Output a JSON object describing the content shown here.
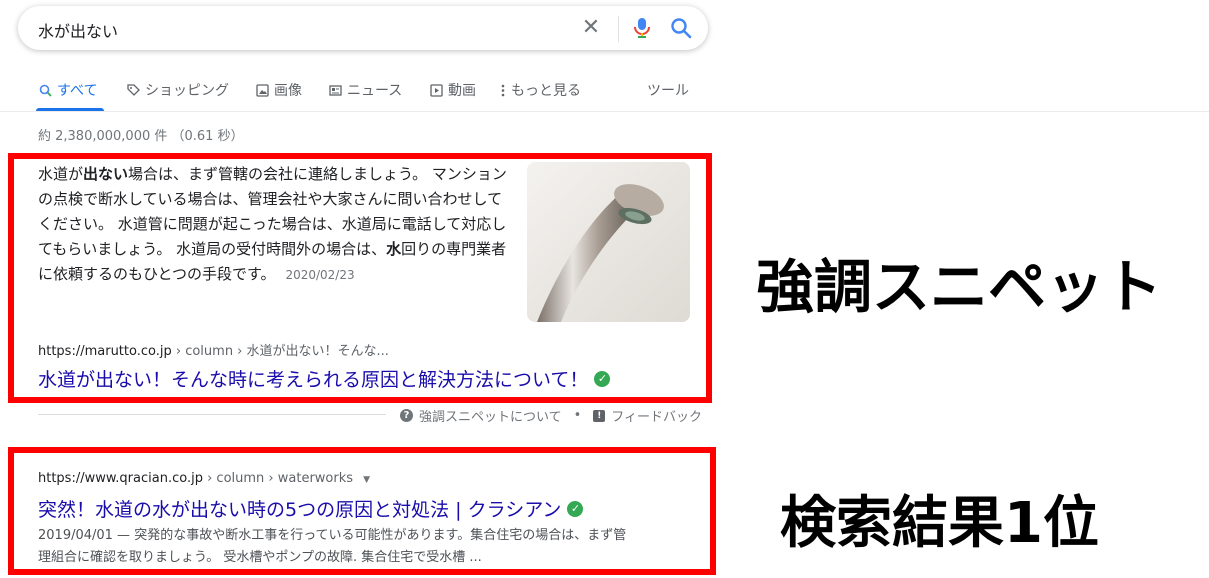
{
  "search": {
    "query": "水が出ない"
  },
  "tabs": [
    {
      "label": "すべて",
      "icon": "search-icon",
      "active": true
    },
    {
      "label": "ショッピング",
      "icon": "tag-icon"
    },
    {
      "label": "画像",
      "icon": "image-icon"
    },
    {
      "label": "ニュース",
      "icon": "news-icon"
    },
    {
      "label": "動画",
      "icon": "play-icon"
    },
    {
      "label": "もっと見る",
      "icon": "more-icon"
    },
    {
      "label": "ツール"
    }
  ],
  "result_stats": "約 2,380,000,000 件 （0.61 秒）",
  "featured_snippet": {
    "t1": "水道が",
    "t1b": "出ない",
    "t2": "場合は、まず管轄の会社に連絡しましょう。 マンションの点検で断水している場合は、管理会社や大家さんに問い合わせしてください。 水道管に問題が起こった場合は、水道局に電話して対応してもらいましょう。 水道局の受付時間外の場合は、",
    "t3b": "水",
    "t3": "回りの専門業者に依頼するのもひとつの手段です。",
    "date": "2020/02/23",
    "cite_domain": "https://marutto.co.jp",
    "cite_path": " › column › 水道が出ない！そんな...",
    "title": "水道が出ない！そんな時に考えられる原因と解決方法について！",
    "about_label": "強調スニペットについて",
    "separator": "•",
    "feedback_label": "フィードバック"
  },
  "first_result": {
    "cite_domain": "https://www.qracian.co.jp",
    "cite_path": " › column › waterworks",
    "title": "突然！水道の水が出ない時の5つの原因と対処法 | クラシアン",
    "description": "2019/04/01 — 突発的な事故や断水工事を行っている可能性があります。集合住宅の場合は、まず管理組合に確認を取りましょう。 受水槽やポンプの故障. 集合住宅で受水槽 ..."
  },
  "annotations": {
    "featured_label": "強調スニペット",
    "first_label": "検索結果1位"
  },
  "colors": {
    "highlight_box": "#ff0000",
    "link": "#1a0dab",
    "accent": "#1a73e8",
    "verified": "#34a853"
  }
}
